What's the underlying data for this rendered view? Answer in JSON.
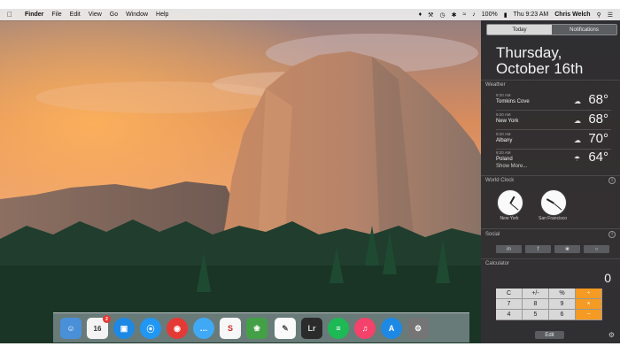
{
  "menubar": {
    "apple": "",
    "items": [
      "Finder",
      "File",
      "Edit",
      "View",
      "Go",
      "Window",
      "Help"
    ],
    "battery": "100%",
    "clock": "Thu 9:23 AM",
    "user": "Chris Welch"
  },
  "notification_center": {
    "tabs": [
      "Today",
      "Notifications"
    ],
    "date_line1": "Thursday,",
    "date_line2": "October 16th",
    "weather": {
      "title": "Weather",
      "rows": [
        {
          "time": "9:20 AM",
          "city": "Tomkins Cove",
          "temp": "68°"
        },
        {
          "time": "9:20 AM",
          "city": "New York",
          "temp": "68°"
        },
        {
          "time": "9:20 AM",
          "city": "Albany",
          "temp": "70°"
        },
        {
          "time": "9:20 AM",
          "city": "Poland",
          "temp": "64°"
        }
      ],
      "show_more": "Show More..."
    },
    "world_clock": {
      "title": "World Clock",
      "clocks": [
        {
          "label": "New York"
        },
        {
          "label": "San Francisco"
        }
      ]
    },
    "social": {
      "title": "Social"
    },
    "calculator": {
      "title": "Calculator",
      "display": "0",
      "keys": [
        [
          "C",
          "+/-",
          "%",
          "÷"
        ],
        [
          "7",
          "8",
          "9",
          "×"
        ],
        [
          "4",
          "5",
          "6",
          "−"
        ]
      ]
    },
    "edit": "Edit"
  },
  "dock": {
    "calendar_date": "16",
    "calendar_badge": "2",
    "lightroom": "Lr"
  },
  "colors": {
    "accent_orange": "#f59a23",
    "nc_background": "#26282c"
  }
}
